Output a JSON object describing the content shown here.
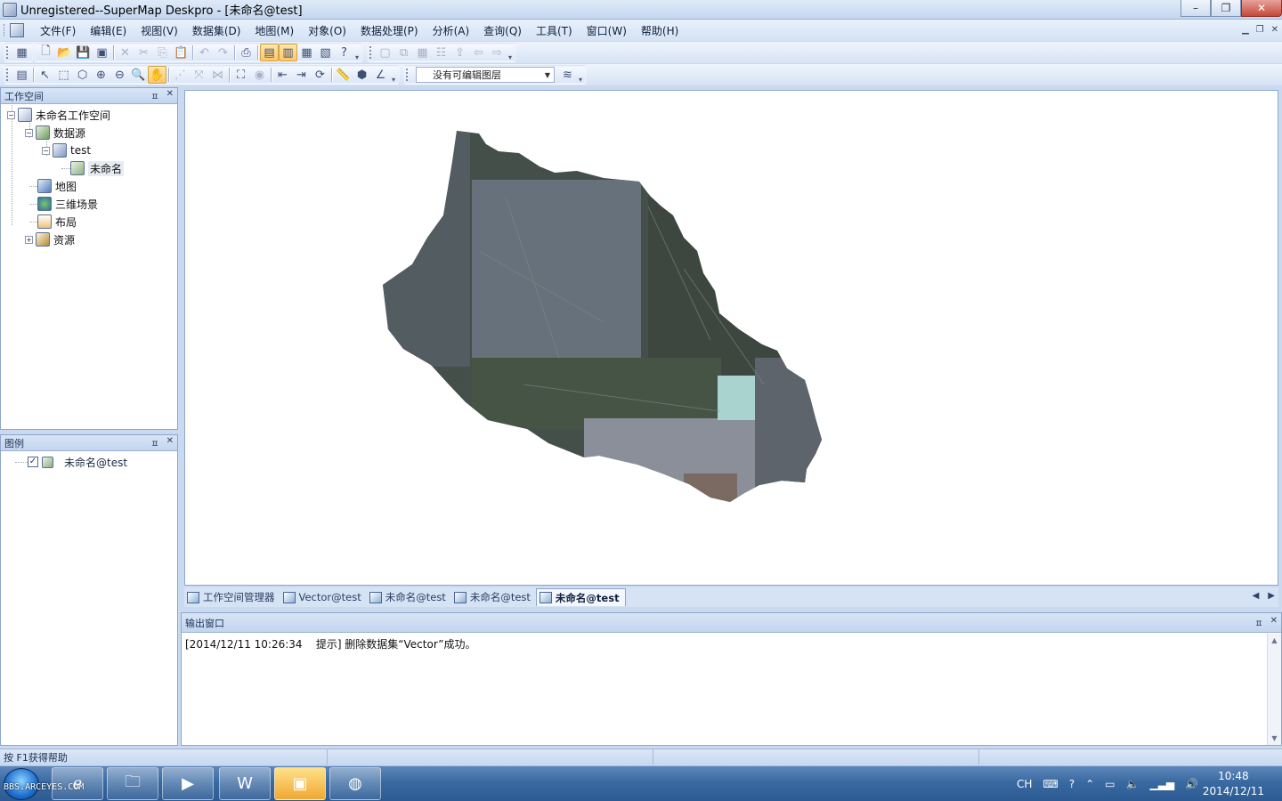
{
  "window": {
    "title": "Unregistered--SuperMap Deskpro - [未命名@test]"
  },
  "menu": [
    "文件(F)",
    "编辑(E)",
    "视图(V)",
    "数据集(D)",
    "地图(M)",
    "对象(O)",
    "数据处理(P)",
    "分析(A)",
    "查询(Q)",
    "工具(T)",
    "窗口(W)",
    "帮助(H)"
  ],
  "toolbar": {
    "layer_select_value": "没有可编辑图层"
  },
  "workspace_panel": {
    "title": "工作空间",
    "nodes": {
      "root": "未命名工作空间",
      "datasources": "数据源",
      "test": "test",
      "dataset": "未命名",
      "maps": "地图",
      "scenes": "三维场景",
      "layouts": "布局",
      "resources": "资源"
    }
  },
  "legend_panel": {
    "title": "图例",
    "layer": "未命名@test"
  },
  "doc_tabs": [
    "工作空间管理器",
    "Vector@test",
    "未命名@test",
    "未命名@test",
    "未命名@test"
  ],
  "output_panel": {
    "title": "输出窗口",
    "message": "[2014/12/11 10:26:34    提示] 删除数据集“Vector”成功。"
  },
  "statusbar": {
    "help": "按 F1获得帮助"
  },
  "taskbar": {
    "watermark": "BBS.ARCEYES.COM",
    "tray_lang": "CH",
    "time": "10:48",
    "date": "2014/12/11"
  },
  "colors": {
    "accent": "#3a6aa2",
    "panel_border": "#8ea6cb",
    "active_tool": "#ffc766"
  }
}
